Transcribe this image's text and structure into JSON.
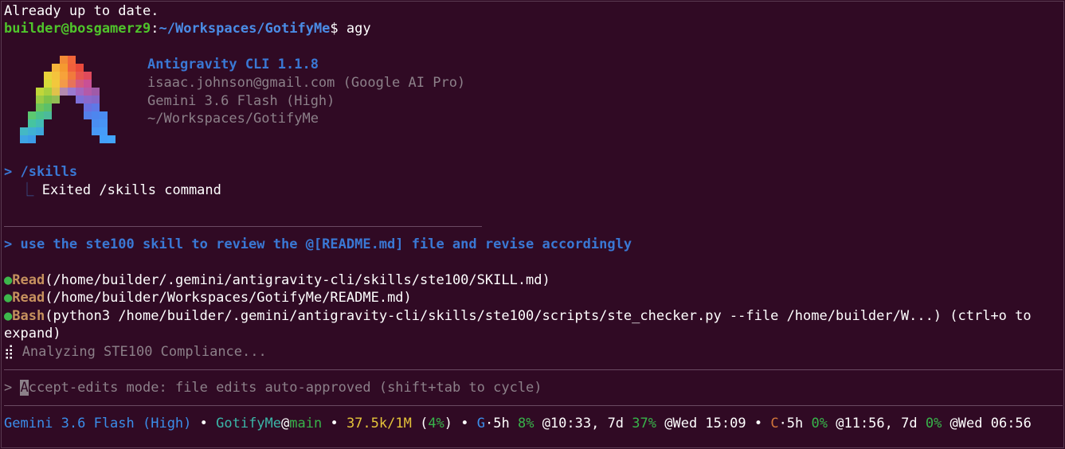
{
  "terminal": {
    "line_already": "Already up to date.",
    "prompt_user": "builder@bosgamerz9",
    "prompt_colon": ":",
    "prompt_path": "~/Workspaces/GotifyMe",
    "prompt_dollar": "$ ",
    "prompt_cmd": "agy"
  },
  "banner": {
    "title": "Antigravity CLI 1.1.8",
    "account": "isaac.johnson@gmail.com (Google AI Pro)",
    "model": "Gemini 3.6 Flash (High)",
    "cwd": "~/Workspaces/GotifyMe"
  },
  "skills_cmd": {
    "prompt": "> /skills",
    "connector": "  ⎿ ",
    "result": "Exited /skills command"
  },
  "user_request": "> use the ste100 skill to review the @[README.md] file and revise accordingly",
  "tool_calls": [
    {
      "dot": "●",
      "name": "Read",
      "args": "(/home/builder/.gemini/antigravity-cli/skills/ste100/SKILL.md)"
    },
    {
      "dot": "●",
      "name": "Read",
      "args": "(/home/builder/Workspaces/GotifyMe/README.md)"
    },
    {
      "dot": "●",
      "name": "Bash",
      "args": "(python3 /home/builder/.gemini/antigravity-cli/skills/ste100/scripts/ste_checker.py --file /home/builder/W...) (ctrl+o to",
      "args_wrap": "expand)"
    }
  ],
  "spinner": {
    "glyph": "⣾",
    "text": " Analyzing STE100 Compliance..."
  },
  "input": {
    "prompt": "> ",
    "cursor_char": "A",
    "placeholder_rest": "ccept-edits mode: file edits auto-approved (shift+tab to cycle)"
  },
  "statusbar": {
    "model": "Gemini 3.6 Flash (High)",
    "bullet": " • ",
    "repo": "GotifyMe",
    "at": "@",
    "branch": "main",
    "tokens": "37.5k/1M",
    "tokens_pct_open": " (",
    "tokens_pct": "4%",
    "tokens_pct_close": ")",
    "g_label": "G",
    "g_5h": "·5h ",
    "g_5h_pct": "8%",
    "g_5h_reset": " @10:33, 7d ",
    "g_7d_pct": "37%",
    "g_7d_reset": " @Wed 15:09",
    "c_label": "C",
    "c_5h": "·5h ",
    "c_5h_pct": "0%",
    "c_5h_reset": " @11:56, 7d ",
    "c_7d_pct": "0%",
    "c_7d_reset": " @Wed 06:56"
  },
  "colors": {
    "background": "#300a24",
    "prompt_user": "#4fc42b",
    "prompt_path": "#4a8ce6",
    "accent_blue": "#3a78d4",
    "tool_name": "#c6915e",
    "status_dot": "#3db74c"
  },
  "logo": {
    "name": "antigravity-logo"
  }
}
